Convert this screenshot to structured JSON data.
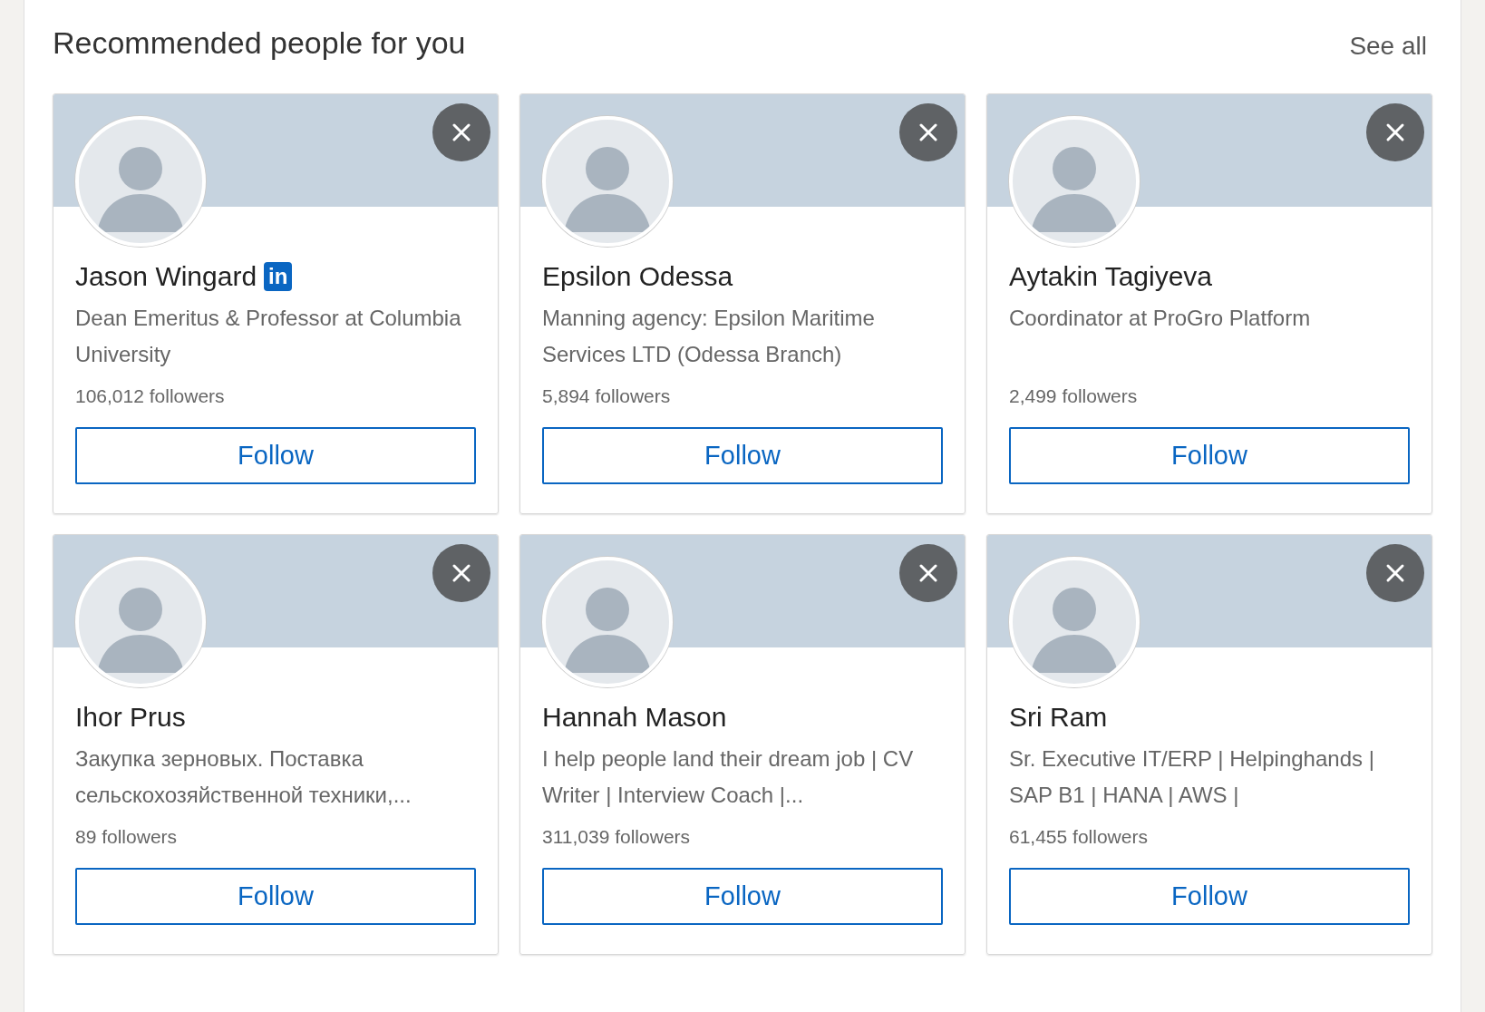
{
  "title": "Recommended people for you",
  "see_all": "See all",
  "people": [
    {
      "name": "Jason Wingard",
      "badge": "in",
      "headline": "Dean Emeritus & Professor at Columbia University",
      "followers": "106,012 followers",
      "button": "Follow"
    },
    {
      "name": "Epsilon Odessa",
      "headline": "Manning agency: Epsilon Maritime Services LTD (Odessa Branch)",
      "followers": "5,894 followers",
      "button": "Follow"
    },
    {
      "name": "Aytakin Tagiyeva",
      "headline": "Coordinator at ProGro Platform",
      "followers": "2,499 followers",
      "button": "Follow"
    },
    {
      "name": "Ihor Prus",
      "headline": "Закупка зерновых. Поставка сельскохозяйственной техники,...",
      "followers": "89 followers",
      "button": "Follow"
    },
    {
      "name": "Hannah Mason",
      "headline": "I help people land their dream job | CV Writer | Interview Coach |...",
      "followers": "311,039 followers",
      "button": "Follow"
    },
    {
      "name": "Sri Ram",
      "headline": "Sr. Executive IT/ERP | Helpinghands | SAP B1 | HANA | AWS |",
      "followers": "61,455 followers",
      "button": "Follow"
    }
  ]
}
